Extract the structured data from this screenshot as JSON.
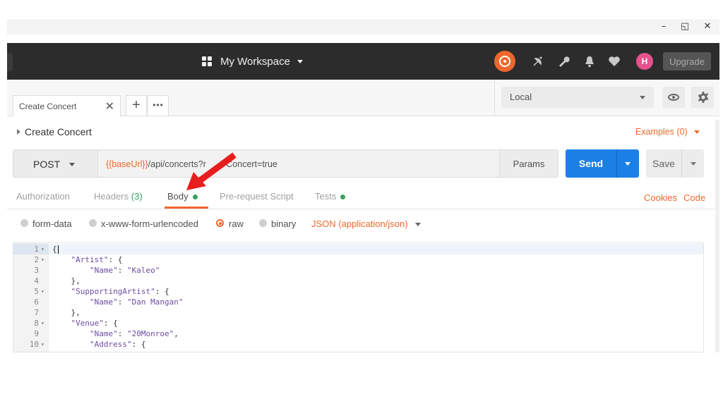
{
  "window_controls": {
    "minimize": "–",
    "restore": "◱",
    "close": "✕"
  },
  "header": {
    "workspace": "My Workspace",
    "upgrade": "Upgrade",
    "avatar_initials": "H",
    "icons": [
      "sync-icon",
      "satellite-icon",
      "wrench-icon",
      "bell-icon",
      "heart-icon"
    ]
  },
  "tabs": {
    "active_tab": "Create Concert",
    "close": "✕",
    "add": "+",
    "more": "•••"
  },
  "environment": {
    "selected": "Local"
  },
  "request": {
    "name": "Create Concert",
    "examples": "Examples (0)",
    "method": "POST",
    "url_variable": "{{baseUrl}}",
    "url_path": "/api/concerts?r",
    "url_hidden": "eturn",
    "url_rest": "Concert=true",
    "params": "Params",
    "send": "Send",
    "save": "Save"
  },
  "subtabs": {
    "authorization": "Authorization",
    "headers": "Headers",
    "headers_count": "(3)",
    "body": "Body",
    "pre_request": "Pre-request Script",
    "tests": "Tests",
    "cookies": "Cookies",
    "code": "Code"
  },
  "body_modes": {
    "form_data": "form-data",
    "urlencoded": "x-www-form-urlencoded",
    "raw": "raw",
    "binary": "binary",
    "content_type": "JSON (application/json)",
    "selected": "raw"
  },
  "editor": {
    "lines": [
      {
        "n": "1",
        "fold": "▾",
        "text": "{"
      },
      {
        "n": "2",
        "fold": "▾",
        "text": "    \"Artist\": {"
      },
      {
        "n": "3",
        "fold": "",
        "text": "        \"Name\": \"Kaleo\""
      },
      {
        "n": "4",
        "fold": "",
        "text": "    },"
      },
      {
        "n": "5",
        "fold": "▾",
        "text": "    \"SupportingArtist\": {"
      },
      {
        "n": "6",
        "fold": "",
        "text": "        \"Name\": \"Dan Mangan\""
      },
      {
        "n": "7",
        "fold": "",
        "text": "    },"
      },
      {
        "n": "8",
        "fold": "▾",
        "text": "    \"Venue\": {"
      },
      {
        "n": "9",
        "fold": "",
        "text": "        \"Name\": \"20Monroe\","
      },
      {
        "n": "10",
        "fold": "▾",
        "text": "        \"Address\": {"
      }
    ]
  },
  "colors": {
    "accent": "#f0672d",
    "send": "#1b7fe6",
    "header_bg": "#2c2c2c",
    "success": "#36a35e",
    "arrow": "#e81d1d"
  }
}
